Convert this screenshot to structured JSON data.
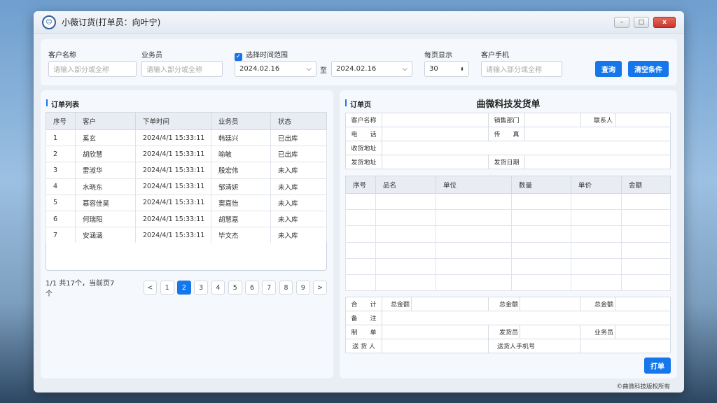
{
  "window": {
    "title": "小薇订货(打单员：向叶宁)",
    "min": "–",
    "max": "□",
    "close": "x"
  },
  "filters": {
    "customer_label": "客户名称",
    "customer_placeholder": "请输入部分或全称",
    "sales_label": "业务员",
    "sales_placeholder": "请输入部分或全称",
    "time_check_label": "选择时间范围",
    "date_from": "2024.02.16",
    "to_label": "至",
    "date_to": "2024.02.16",
    "page_size_label": "每页显示",
    "page_size": "30",
    "phone_label": "客户手机",
    "phone_placeholder": "请输入部分或全称",
    "query_button": "查询",
    "clear_button": "清空条件"
  },
  "orders": {
    "title": "订单列表",
    "headers": [
      "序号",
      "客户",
      "下单时间",
      "业务员",
      "状态"
    ],
    "rows": [
      {
        "no": "1",
        "customer": "奚玄",
        "time": "2024/4/1 15:33:11",
        "sales": "韩廷兴",
        "status": "已出库",
        "done": true
      },
      {
        "no": "2",
        "customer": "胡欣慧",
        "time": "2024/4/1 15:33:11",
        "sales": "喻敏",
        "status": "已出库",
        "done": true
      },
      {
        "no": "3",
        "customer": "雷淑华",
        "time": "2024/4/1 15:33:11",
        "sales": "殷宏伟",
        "status": "未入库",
        "done": false
      },
      {
        "no": "4",
        "customer": "水晓东",
        "time": "2024/4/1 15:33:11",
        "sales": "邹清妍",
        "status": "未入库",
        "done": false
      },
      {
        "no": "5",
        "customer": "慕容佳昊",
        "time": "2024/4/1 15:33:11",
        "sales": "窦嘉怡",
        "status": "未入库",
        "done": false
      },
      {
        "no": "6",
        "customer": "何瑞阳",
        "time": "2024/4/1 15:33:11",
        "sales": "胡慧嘉",
        "status": "未入库",
        "done": false
      },
      {
        "no": "7",
        "customer": "安涵涵",
        "time": "2024/4/1 15:33:11",
        "sales": "毕文杰",
        "status": "未入库",
        "done": false
      }
    ],
    "pager_info": "1/1  共17个，当前页7个",
    "pages": [
      "1",
      "2",
      "3",
      "4",
      "5",
      "6",
      "7",
      "8",
      "9"
    ],
    "active_page": "2",
    "prev": "<",
    "next": ">"
  },
  "invoice": {
    "panel_title": "订单页",
    "heading": "曲微科技发货单",
    "customer_name": "客户名称",
    "sales_dept": "销售部门",
    "contact": "联系人",
    "phone": "电　　话",
    "fax": "传　　真",
    "receive_addr": "收货地址",
    "ship_addr": "发货地址",
    "ship_date": "发货日期",
    "item_headers": [
      "序号",
      "品名",
      "单位",
      "数量",
      "单价",
      "金额"
    ],
    "total": "合　　计",
    "total_amount": "总金额",
    "remark": "备　　注",
    "maker": "制　　单",
    "shipper": "发货员",
    "salesman": "业务员",
    "deliverer": "送 货 人",
    "deliverer_phone": "送货人手机号",
    "print_button": "打单"
  },
  "footer": "©曲微科技版权所有"
}
